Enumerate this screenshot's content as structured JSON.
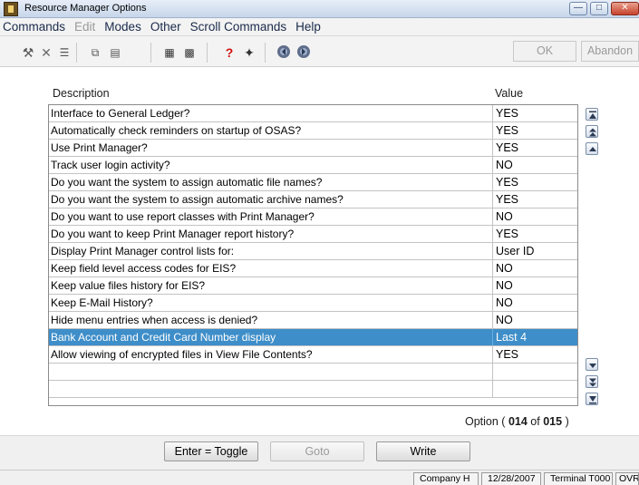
{
  "window": {
    "title": "Resource Manager Options",
    "minimize_icon": "minimize-icon",
    "maximize_icon": "maximize-icon",
    "close_icon": "close-icon"
  },
  "menu": [
    "Commands",
    "Edit",
    "Modes",
    "Other",
    "Scroll Commands",
    "Help"
  ],
  "menu_disabled": [
    "Edit"
  ],
  "toolbar": {
    "icons": [
      "tools-icon",
      "delete-icon",
      "list-icon",
      "copy-icon",
      "paste-icon",
      "calculator-icon",
      "calendar-icon",
      "help-icon",
      "book-icon",
      "back-globe-icon",
      "forward-globe-icon"
    ],
    "ok_label": "OK",
    "abandon_label": "Abandon"
  },
  "table": {
    "headers": {
      "description": "Description",
      "value": "Value"
    },
    "rows": [
      {
        "description": "Interface to General Ledger?",
        "value": "YES"
      },
      {
        "description": "Automatically check reminders on startup of OSAS?",
        "value": "YES"
      },
      {
        "description": "Use Print Manager?",
        "value": "YES"
      },
      {
        "description": "Track user login activity?",
        "value": "NO"
      },
      {
        "description": "Do you want the system to assign automatic file names?",
        "value": "YES"
      },
      {
        "description": "Do you want the system to assign automatic archive names?",
        "value": "YES"
      },
      {
        "description": "Do you want to use report classes with Print Manager?",
        "value": "NO"
      },
      {
        "description": "Do you want to keep Print Manager report history?",
        "value": "YES"
      },
      {
        "description": "Display Print Manager control lists for:",
        "value": "User ID"
      },
      {
        "description": "Keep field level access codes for EIS?",
        "value": "NO"
      },
      {
        "description": "Keep value files history for EIS?",
        "value": "NO"
      },
      {
        "description": "Keep E-Mail History?",
        "value": "NO"
      },
      {
        "description": "Hide menu entries when access is denied?",
        "value": "NO"
      },
      {
        "description": "Bank Account and Credit Card Number display",
        "value": "Last 4"
      },
      {
        "description": "Allow viewing of encrypted files in View File Contents?",
        "value": "YES"
      },
      {
        "description": "",
        "value": ""
      },
      {
        "description": "",
        "value": ""
      }
    ],
    "selected_index": 13
  },
  "option": {
    "prefix": "Option (",
    "current": "014",
    "of": "of",
    "total": "015",
    "suffix": ")"
  },
  "buttons": {
    "toggle_label": "Enter = Toggle",
    "goto_label": "Goto",
    "write_label": "Write"
  },
  "status": {
    "company": "Company H",
    "date": "12/28/2007",
    "terminal": "Terminal T000",
    "mode": "OVR"
  },
  "colors": {
    "selection": "#3e8ec9",
    "title_gradient_top": "#e7eef8",
    "close_button": "#c7422c"
  }
}
